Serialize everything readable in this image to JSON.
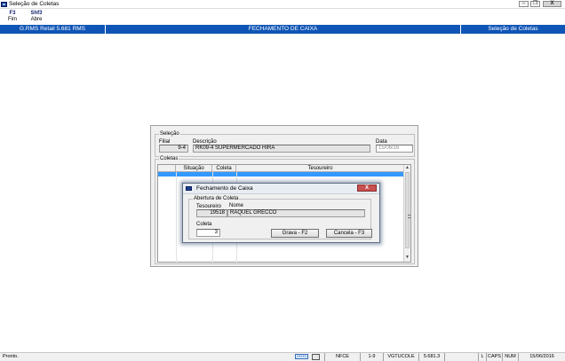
{
  "window": {
    "title": "Seleção de Coletas",
    "controls": [
      "–",
      "❐",
      "X"
    ]
  },
  "toolbar": {
    "items": [
      {
        "key": "F3",
        "label": "Fim"
      },
      {
        "key": "Shf3",
        "label": "Abre"
      }
    ]
  },
  "header": {
    "app": "G.RMS Retail 5.681 RMS",
    "center": "FECHAMENTO DE CAIXA",
    "right": "Seleção de Coletas"
  },
  "selecao": {
    "legend": "Seleção",
    "filial_label": "Filial",
    "filial_value": "9-4",
    "descricao_label": "Descrição",
    "descricao_value": "RK09-4 SUPERMERCADO HIRA",
    "data_label": "Data",
    "data_value": "15/06/16"
  },
  "coletas": {
    "legend": "Coletas",
    "columns": [
      "Situação",
      "Coleta",
      "Tesoureiro"
    ]
  },
  "dialog": {
    "title": "Fechamento de Caixa",
    "group_label": "Abertura de Coleta",
    "tesoureiro_label": "Tesoureiro",
    "nome_label": "Nome",
    "tesoureiro_value": "19518",
    "nome_value": "RAQUEL GRECCO",
    "coleta_label": "Coleta",
    "coleta_value": "3",
    "grava_label": "Grava - F2",
    "cancela_label": "Cancela - F3",
    "close_label": "X"
  },
  "statusbar": {
    "left": "Pronto.",
    "nfce": "NFCE",
    "filial": "1-9",
    "program": "VGTUCOLE",
    "version": "5.681.3",
    "l": "L",
    "caps": "CAPS",
    "num": "NUM",
    "date": "15/06/2016"
  }
}
